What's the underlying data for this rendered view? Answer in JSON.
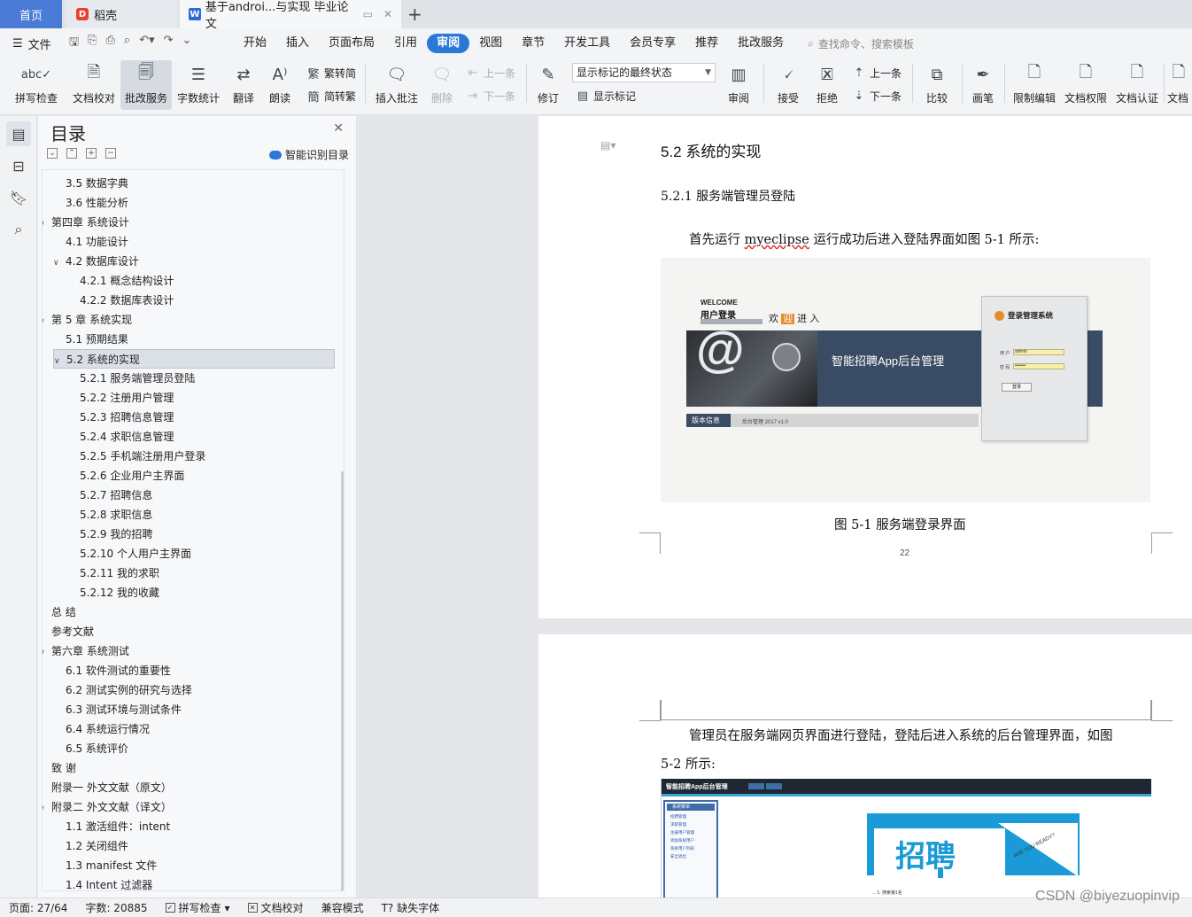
{
  "tabs": {
    "home": "首页",
    "daoke": "稻壳",
    "doc": "基于androi...与实现 毕业论文"
  },
  "menu": {
    "file": "文件",
    "items": [
      "开始",
      "插入",
      "页面布局",
      "引用",
      "审阅",
      "视图",
      "章节",
      "开发工具",
      "会员专享",
      "推荐",
      "批改服务"
    ],
    "active": "审阅",
    "search_placeholder": "查找命令、搜索模板"
  },
  "ribbon": {
    "spellcheck": "拼写检查",
    "doc_proof": "文档校对",
    "correction_service": "批改服务",
    "word_count": "字数统计",
    "translate": "翻译",
    "read_aloud": "朗读",
    "to_traditional": "繁转简",
    "to_simplified": "简转繁",
    "insert_comment": "插入批注",
    "delete": "删除",
    "prev_comment": "上一条",
    "next_comment": "下一条",
    "revise": "修订",
    "markup_state": "显示标记的最终状态",
    "show_markup": "显示标记",
    "review": "审阅",
    "accept": "接受",
    "reject": "拒绝",
    "prev_change": "上一条",
    "next_change": "下一条",
    "compare": "比较",
    "ink": "画笔",
    "restrict_edit": "限制编辑",
    "doc_permission": "文档权限",
    "doc_cert": "文档认证",
    "doc_more": "文档"
  },
  "toc": {
    "title": "目录",
    "smart": "智能识别目录",
    "items": [
      {
        "label": "3.5  数据字典",
        "level": 2,
        "chev": ""
      },
      {
        "label": "3.6  性能分析",
        "level": 2,
        "chev": ""
      },
      {
        "label": "第四章  系统设计",
        "level": 1,
        "chev": "open"
      },
      {
        "label": "4.1  功能设计",
        "level": 2,
        "chev": ""
      },
      {
        "label": "4.2  数据库设计",
        "level": 2,
        "chev": "open"
      },
      {
        "label": "4.2.1 概念结构设计",
        "level": 3,
        "chev": ""
      },
      {
        "label": "4.2.2 数据库表设计",
        "level": 3,
        "chev": ""
      },
      {
        "label": "第 5 章  系统实现",
        "level": 1,
        "chev": "open"
      },
      {
        "label": "5.1 预期结果",
        "level": 2,
        "chev": ""
      },
      {
        "label": "5.2 系统的实现",
        "level": 2,
        "chev": "open",
        "selected": true
      },
      {
        "label": "5.2.1  服务端管理员登陆",
        "level": 3,
        "chev": ""
      },
      {
        "label": "5.2.2  注册用户管理",
        "level": 3,
        "chev": ""
      },
      {
        "label": "5.2.3  招聘信息管理",
        "level": 3,
        "chev": ""
      },
      {
        "label": "5.2.4  求职信息管理",
        "level": 3,
        "chev": ""
      },
      {
        "label": "5.2.5  手机端注册用户登录",
        "level": 3,
        "chev": ""
      },
      {
        "label": "5.2.6  企业用户主界面",
        "level": 3,
        "chev": ""
      },
      {
        "label": "5.2.7  招聘信息",
        "level": 3,
        "chev": ""
      },
      {
        "label": "5.2.8  求职信息",
        "level": 3,
        "chev": ""
      },
      {
        "label": "5.2.9  我的招聘",
        "level": 3,
        "chev": ""
      },
      {
        "label": "5.2.10  个人用户主界面",
        "level": 3,
        "chev": ""
      },
      {
        "label": "5.2.11  我的求职",
        "level": 3,
        "chev": ""
      },
      {
        "label": "5.2.12  我的收藏",
        "level": 3,
        "chev": ""
      },
      {
        "label": "总    结",
        "level": 1,
        "chev": ""
      },
      {
        "label": "参考文献",
        "level": 1,
        "chev": ""
      },
      {
        "label": "第六章  系统测试",
        "level": 1,
        "chev": "open"
      },
      {
        "label": "6.1  软件测试的重要性",
        "level": 2,
        "chev": ""
      },
      {
        "label": "6.2  测试实例的研究与选择",
        "level": 2,
        "chev": ""
      },
      {
        "label": "6.3  测试环境与测试条件",
        "level": 2,
        "chev": ""
      },
      {
        "label": "6.4  系统运行情况",
        "level": 2,
        "chev": ""
      },
      {
        "label": "6.5  系统评价",
        "level": 2,
        "chev": ""
      },
      {
        "label": "致    谢",
        "level": 1,
        "chev": ""
      },
      {
        "label": "附录一  外文文献（原文）",
        "level": 1,
        "chev": ""
      },
      {
        "label": "附录二  外文文献（译文）",
        "level": 1,
        "chev": "open"
      },
      {
        "label": "1.1 激活组件：intent",
        "level": 2,
        "chev": ""
      },
      {
        "label": "1.2 关闭组件",
        "level": 2,
        "chev": ""
      },
      {
        "label": "1.3 manifest 文件",
        "level": 2,
        "chev": ""
      },
      {
        "label": "1.4 Intent 过滤器",
        "level": 2,
        "chev": ""
      }
    ]
  },
  "document": {
    "h2": "5.2 系统的实现",
    "h3": "5.2.1  服务端管理员登陆",
    "para1_a": "首先运行 ",
    "para1_word": "myeclipse",
    "para1_b": " 运行成功后进入登陆界面如图 5-1 所示:",
    "fig1_caption": "图 5-1  服务端登录界面",
    "page_number": "22",
    "para2_line1": "管理员在服务端网页界面进行登陆，登陆后进入系统的后台管理界面，如图",
    "para2_line2": "5-2 所示:"
  },
  "figure1": {
    "welcome": "WELCOME",
    "user_login": "用户登录",
    "huan": "欢",
    "ying": "迎",
    "jin": "进",
    "ru": "入",
    "app_title": "智能招聘App后台管理",
    "version_tag": "版本信息",
    "version_text": "后台管理 2017 v1.0",
    "login_title": "登录管理系统",
    "user_label": "用 户",
    "user_value": "admin",
    "pwd_label": "密 码",
    "pwd_value": "•••••••",
    "login_btn": "登录"
  },
  "figure2": {
    "top_title": "智能招聘App后台管理",
    "side_head": "系统菜单",
    "side_items": [
      "招聘管理",
      "求职管理",
      "注册用户管理",
      "添加系统用户",
      "系统用户列表",
      "安全退出"
    ],
    "poster": "招聘",
    "slogan": "ARE YOU READY?",
    "step": "→ 1. 搜索第1名"
  },
  "status": {
    "page": "页面: 27/64",
    "words": "字数: 20885",
    "spell": "拼写检查",
    "proof": "文档校对",
    "compat": "兼容模式",
    "missing_font": "缺失字体"
  },
  "watermark": "CSDN @biyezuopinvip"
}
